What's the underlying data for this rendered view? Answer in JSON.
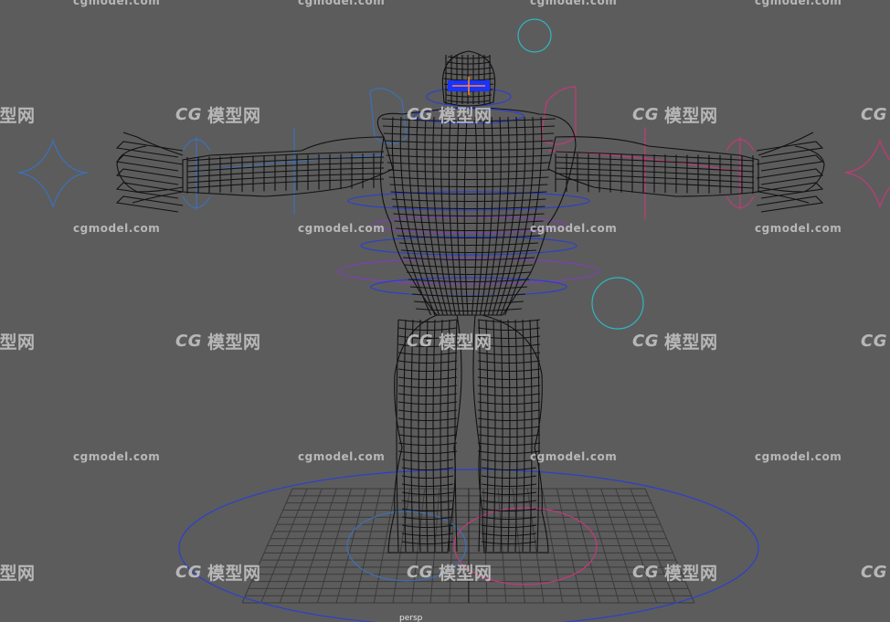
{
  "viewport": {
    "camera_label": "persp",
    "background": "#5c5c5c"
  },
  "watermark": {
    "url_text": "cgmodel.com",
    "logo_mark": "CG",
    "logo_text": "模型网"
  },
  "colors": {
    "wireframe": "#111111",
    "grid": "#3a3a3a",
    "control_blue": "#2a3fd0",
    "control_light_blue": "#3d70b8",
    "control_pink": "#c23a78",
    "control_purple": "#7e3fb6",
    "control_cyan": "#2fb6c2",
    "eye_blue": "#1a33ff",
    "eye_orange": "#ff8a2a"
  }
}
